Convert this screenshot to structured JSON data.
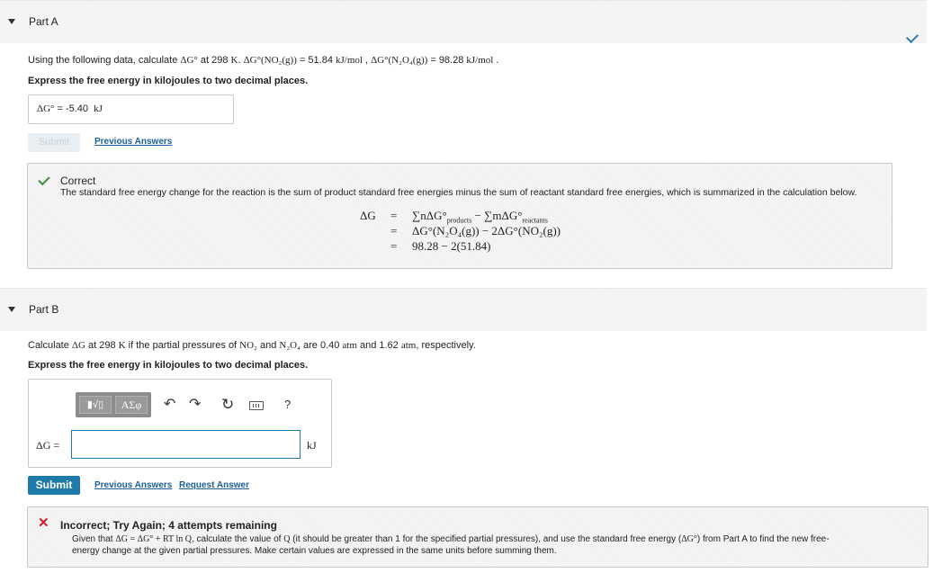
{
  "partA": {
    "title": "Part A",
    "question_prefix": "Using the following data, calculate ",
    "q_dg": "ΔG°",
    "q_at": " at 298 ",
    "q_K": "K",
    "q_dot": ". ",
    "q_no2": "ΔG°(NO₂(g))",
    "q_eq1": " = 51.84 ",
    "q_unit": "kJ/mol",
    "q_comma": " , ",
    "q_n2o4": "ΔG°(N₂O₄(g))",
    "q_eq2": " = 98.28 ",
    "q_end": " .",
    "instruction": "Express the free energy in kilojoules to two decimal places.",
    "answer_label": "ΔG°",
    "answer_eq": " = ",
    "answer_value": "-5.40",
    "answer_unit": "kJ",
    "submit_label": "Submit",
    "previous_answers": "Previous Answers",
    "feedback": {
      "status": "Correct",
      "text": "The standard free energy change for the reaction is the sum of product standard free energies minus the sum of reactant standard free energies, which is summarized in the calculation below.",
      "calc_lhs": "ΔG",
      "eq_sign": "=",
      "row1_a": "∑nΔG°",
      "row1_a_sub": "products",
      "row1_b": " − ∑mΔG°",
      "row1_b_sub": "reactants",
      "row2": "ΔG°(N₂O₄(g)) − 2ΔG°(NO₂(g))",
      "row3": "98.28 − 2(51.84)"
    }
  },
  "partB": {
    "title": "Part B",
    "q_prefix": "Calculate ",
    "q_dg": "ΔG",
    "q_at": " at 298 ",
    "q_K": "K",
    "q_mid": " if the partial pressures of ",
    "q_no2": "NO₂",
    "q_and": " and ",
    "q_n2o4": "N₂O₄",
    "q_are": " are 0.40 ",
    "q_atm": "atm",
    "q_and2": " and 1.62 ",
    "q_end": ", respectively.",
    "instruction": "Express the free energy in kilojoules to two decimal places.",
    "toolbar": {
      "templates": "▮√▯",
      "greek": "ΑΣφ",
      "undo_icon": "undo-icon",
      "redo_icon": "redo-icon",
      "reset_icon": "reset-icon",
      "keyboard_icon": "keyboard-icon",
      "help": "?"
    },
    "input_label": "ΔG =",
    "input_value": "",
    "input_unit": "kJ",
    "submit_label": "Submit",
    "previous_answers": "Previous Answers",
    "request_answer": "Request Answer",
    "feedback": {
      "status": "Incorrect; Try Again; 4 attempts remaining",
      "line1_a": "Given that ",
      "line1_formula": "ΔG = ΔG° + RT ln Q",
      "line1_b": ", calculate the value of ",
      "line1_Q": "Q",
      "line1_c": " (it should be greater than 1 for the specified partial pressures), and use the standard free energy (",
      "line1_dg": "ΔG°",
      "line1_d": ") from Part A to find the new free-",
      "line2": "energy change at the given partial pressures. Make certain values are expressed in the same units before summing them."
    }
  },
  "colors": {
    "accent": "#1e7aa8",
    "correct_green": "#3f8f3f",
    "incorrect_red": "#d0202a",
    "link": "#1a5f99"
  }
}
